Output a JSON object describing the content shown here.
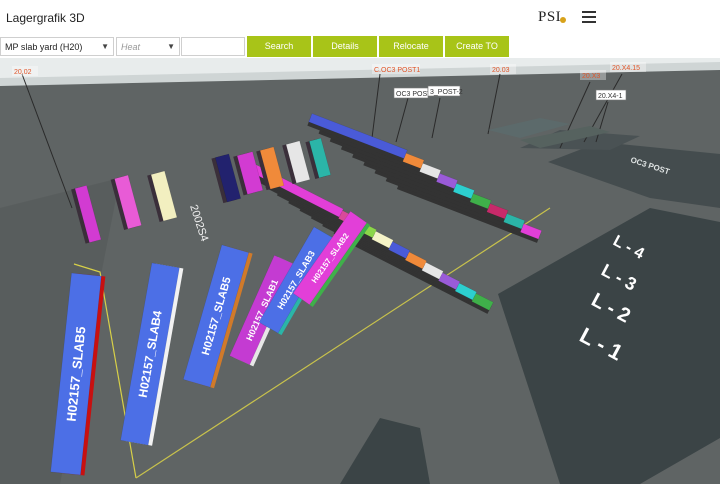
{
  "header": {
    "title": "Lagergrafik 3D",
    "brand": "PSI",
    "menu_icon": "hamburger-icon"
  },
  "toolbar": {
    "yard_select": "MP slab yard (H20)",
    "heat_placeholder": "Heat",
    "search_value": "",
    "search_label": "Search",
    "details_label": "Details",
    "relocate_label": "Relocate",
    "create_to_label": "Create TO",
    "accent_color": "#a8c418"
  },
  "scene": {
    "floor_color": "#5f6464",
    "sky_color": "#e8ecec",
    "tags": [
      {
        "text": "20.02",
        "style": "orange"
      },
      {
        "text": "C.OC3 POST1",
        "style": "orange"
      },
      {
        "text": "OC3 POST1",
        "style": "boxed"
      },
      {
        "text": "3_POST-2",
        "style": "boxed"
      },
      {
        "text": "20.03",
        "style": "orange"
      },
      {
        "text": "20.X3",
        "style": "orange"
      },
      {
        "text": "20.X4.15",
        "style": "orange"
      },
      {
        "text": "20.X4-1",
        "style": "boxed"
      }
    ],
    "slab_labels": [
      "H02157_SLAB5",
      "H02157_SLAB4",
      "H02157_SLAB5",
      "H02157_SLAB1",
      "H02157_SLAB3",
      "H02157_SLAB2",
      "2002S4"
    ],
    "floor_marks": [
      "L-4",
      "L-3",
      "L-2",
      "L-1",
      "OC3 POST1",
      "OC3 POST2"
    ]
  }
}
